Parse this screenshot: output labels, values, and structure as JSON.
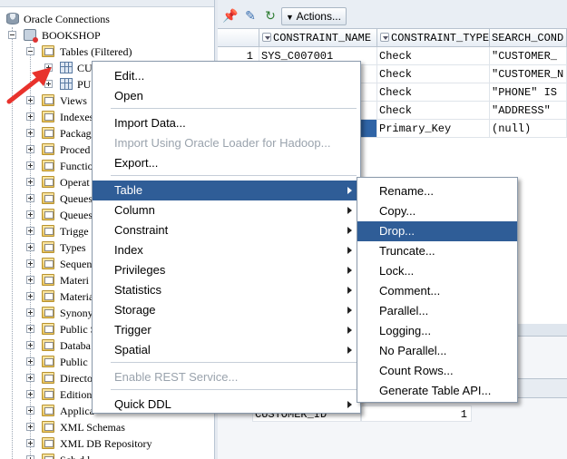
{
  "navigator": {
    "root": "Oracle Connections",
    "connection": "BOOKSHOP",
    "tables_node": "Tables (Filtered)",
    "table_1": "CU",
    "table_2": "PU",
    "nodes": [
      "Views",
      "Indexes",
      "Packag",
      "Proced",
      "Functio",
      "Operat",
      "Queues",
      "Queues",
      "Trigge",
      "Types",
      "Sequen",
      "Materi",
      "Materia",
      "Synony",
      "Public S",
      "Databa",
      "Public",
      "Directo",
      "Edition",
      "Applica",
      "XML Schemas",
      "XML DB Repository",
      "Sch d l"
    ]
  },
  "toolbar": {
    "actions_label": "Actions..."
  },
  "grid": {
    "columns": [
      "CONSTRAINT_NAME",
      "CONSTRAINT_TYPE",
      "SEARCH_COND"
    ],
    "rows": [
      {
        "num": "1",
        "name": "SYS_C007001",
        "type": "Check",
        "search": "\"CUSTOMER_"
      },
      {
        "num": "",
        "name": "",
        "type": "Check",
        "search": "\"CUSTOMER_N"
      },
      {
        "num": "",
        "name": "",
        "type": "Check",
        "search": "\"PHONE\" IS"
      },
      {
        "num": "",
        "name": "",
        "type": "Check",
        "search": "\"ADDRESS\""
      },
      {
        "num": "",
        "name": "",
        "type": "Primary_Key",
        "search": "(null)"
      }
    ]
  },
  "lower": {
    "row_label": "CUSTOMER_ID",
    "row_value": "1"
  },
  "context_menu": {
    "items": [
      {
        "label": "Edit...",
        "disabled": false,
        "submenu": false
      },
      {
        "label": "Open",
        "disabled": false,
        "submenu": false
      },
      {
        "label": "Import Data...",
        "disabled": false,
        "submenu": false
      },
      {
        "label": "Import Using Oracle Loader for Hadoop...",
        "disabled": true,
        "submenu": false
      },
      {
        "label": "Export...",
        "disabled": false,
        "submenu": false
      },
      {
        "label": "Table",
        "disabled": false,
        "submenu": true,
        "highlighted": true
      },
      {
        "label": "Column",
        "disabled": false,
        "submenu": true
      },
      {
        "label": "Constraint",
        "disabled": false,
        "submenu": true
      },
      {
        "label": "Index",
        "disabled": false,
        "submenu": true
      },
      {
        "label": "Privileges",
        "disabled": false,
        "submenu": true
      },
      {
        "label": "Statistics",
        "disabled": false,
        "submenu": true
      },
      {
        "label": "Storage",
        "disabled": false,
        "submenu": true
      },
      {
        "label": "Trigger",
        "disabled": false,
        "submenu": true
      },
      {
        "label": "Spatial",
        "disabled": false,
        "submenu": true
      },
      {
        "label": "Enable REST Service...",
        "disabled": true,
        "submenu": false
      },
      {
        "label": "Quick DDL",
        "disabled": false,
        "submenu": true
      }
    ]
  },
  "table_submenu": {
    "items": [
      {
        "label": "Rename..."
      },
      {
        "label": "Copy..."
      },
      {
        "label": "Drop...",
        "highlighted": true
      },
      {
        "label": "Truncate..."
      },
      {
        "label": "Lock..."
      },
      {
        "label": "Comment..."
      },
      {
        "label": "Parallel..."
      },
      {
        "label": "Logging..."
      },
      {
        "label": "No Parallel..."
      },
      {
        "label": "Count Rows..."
      },
      {
        "label": "Generate Table API..."
      }
    ]
  },
  "colors": {
    "menu_highlight": "#2f5d97",
    "grid_selection": "#2f64a6",
    "annotation_arrow": "#e8322c"
  },
  "icons": [
    "pin-icon",
    "pencil-icon",
    "refresh-icon",
    "actions-dropdown-icon",
    "database-icon",
    "connection-icon",
    "folder-icon",
    "table-icon"
  ]
}
